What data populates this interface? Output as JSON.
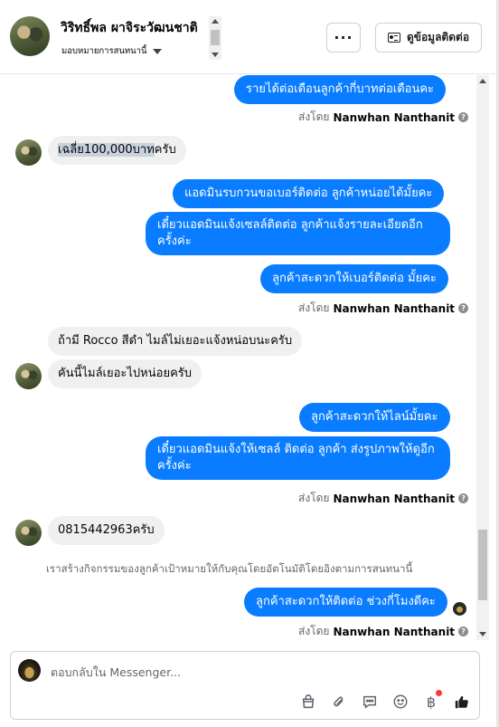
{
  "header": {
    "contact_name": "วิริทธิ์พล ผาจิระวัฒนชาติ",
    "assign_label": "มอบหมายการสนทนานี้",
    "more_label": "···",
    "info_button_label": "ดูข้อมูลติดต่อ"
  },
  "conversation": {
    "sent_by_prefix": "ส่งโดย",
    "sender_name": "Nanwhan Nanthanit",
    "info_glyph": "?",
    "messages": {
      "m1": "รายได้ต่อเดือนลูกค้ากี่บาทต่อเดือนคะ",
      "m2_highlight": "เฉลี่ย100,000บาท",
      "m2_rest": "ครับ",
      "m3": "แอดมินรบกวนขอเบอร์ติดต่อ ลูกค้าหน่อยได้มั้ยคะ",
      "m4": "เดี๋ยวแอดมินแจ้งเซลล์ติดต่อ ลูกค้าแจ้งรายละเอียดอีกครั้งค่ะ",
      "m5": "ลูกค้าสะดวกให้เบอร์ติดต่อ มั้ยคะ",
      "m6": "ถ้ามี Rocco สีดำ ไมล์ไม่เยอะแจ้งหน่อบนะครับ",
      "m7": "คันนี้ไมล์เยอะไปหน่อยครับ",
      "m8": "ลูกค้าสะดวกให้ไลน์มั้ยคะ",
      "m9": "เดี๋ยวแอดมินแจ้งให้เซลล์ ติดต่อ ลูกค้า ส่งรูปภาพให้ดูอีกครั้งค่ะ",
      "m10": "0815442963ครับ",
      "m11": "ลูกค้าสะดวกให้ติดต่อ ช่วงกี่โมงดีคะ"
    },
    "system_note": "เราสร้างกิจกรรมของลูกค้าเป้าหมายให้กับคุณโดยอัตโนมัติโดยอิงตามการสนทนานี้"
  },
  "composer": {
    "placeholder": "ตอบกลับใน Messenger...",
    "currency_symbol": "฿"
  },
  "icons": [
    "chevron-down-icon",
    "contact-card-icon",
    "info-icon",
    "bag-icon",
    "paperclip-icon",
    "speech-bubble-icon",
    "smiley-icon",
    "baht-icon",
    "thumbs-up-icon"
  ],
  "colors": {
    "outgoing_bubble": "#0a7cff",
    "incoming_bubble": "#f0f0f0",
    "highlight": "#c7d1e0",
    "like_button": "#1c1e21",
    "notification_dot": "#fa383e"
  }
}
